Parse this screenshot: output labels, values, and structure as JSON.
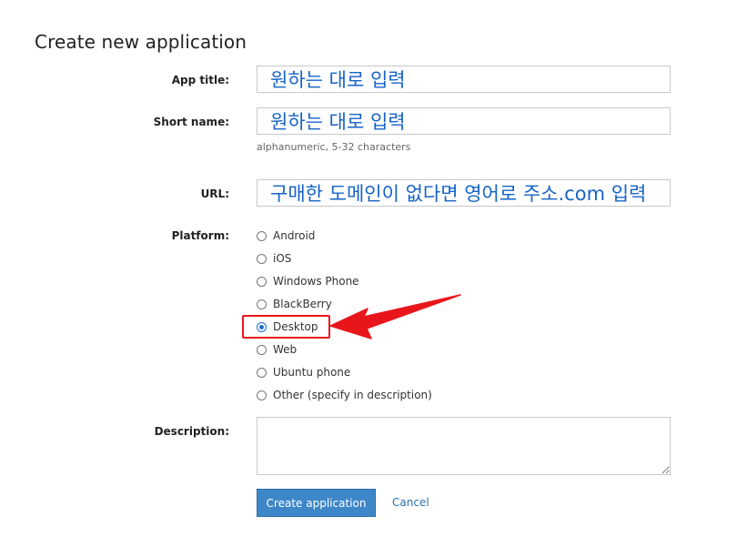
{
  "page": {
    "title": "Create new application"
  },
  "form": {
    "app_title": {
      "label": "App title:",
      "value": "원하는 대로 입력"
    },
    "short_name": {
      "label": "Short name:",
      "value": "원하는 대로 입력",
      "help": "alphanumeric, 5-32 characters"
    },
    "url": {
      "label": "URL:",
      "value": "구매한 도메인이 없다면 영어로 주소.com 입력"
    },
    "platform": {
      "label": "Platform:",
      "selected": "Desktop",
      "options": [
        {
          "label": "Android",
          "checked": false
        },
        {
          "label": "iOS",
          "checked": false
        },
        {
          "label": "Windows Phone",
          "checked": false
        },
        {
          "label": "BlackBerry",
          "checked": false
        },
        {
          "label": "Desktop",
          "checked": true
        },
        {
          "label": "Web",
          "checked": false
        },
        {
          "label": "Ubuntu phone",
          "checked": false
        },
        {
          "label": "Other (specify in description)",
          "checked": false
        }
      ]
    },
    "description": {
      "label": "Description:",
      "value": ""
    },
    "submit_label": "Create application",
    "cancel_label": "Cancel"
  },
  "annotation": {
    "color": "#e8161b",
    "target": "Desktop"
  },
  "colors": {
    "accent": "#3d87c8",
    "link": "#2a6fb0",
    "input_text": "#1663c7"
  }
}
